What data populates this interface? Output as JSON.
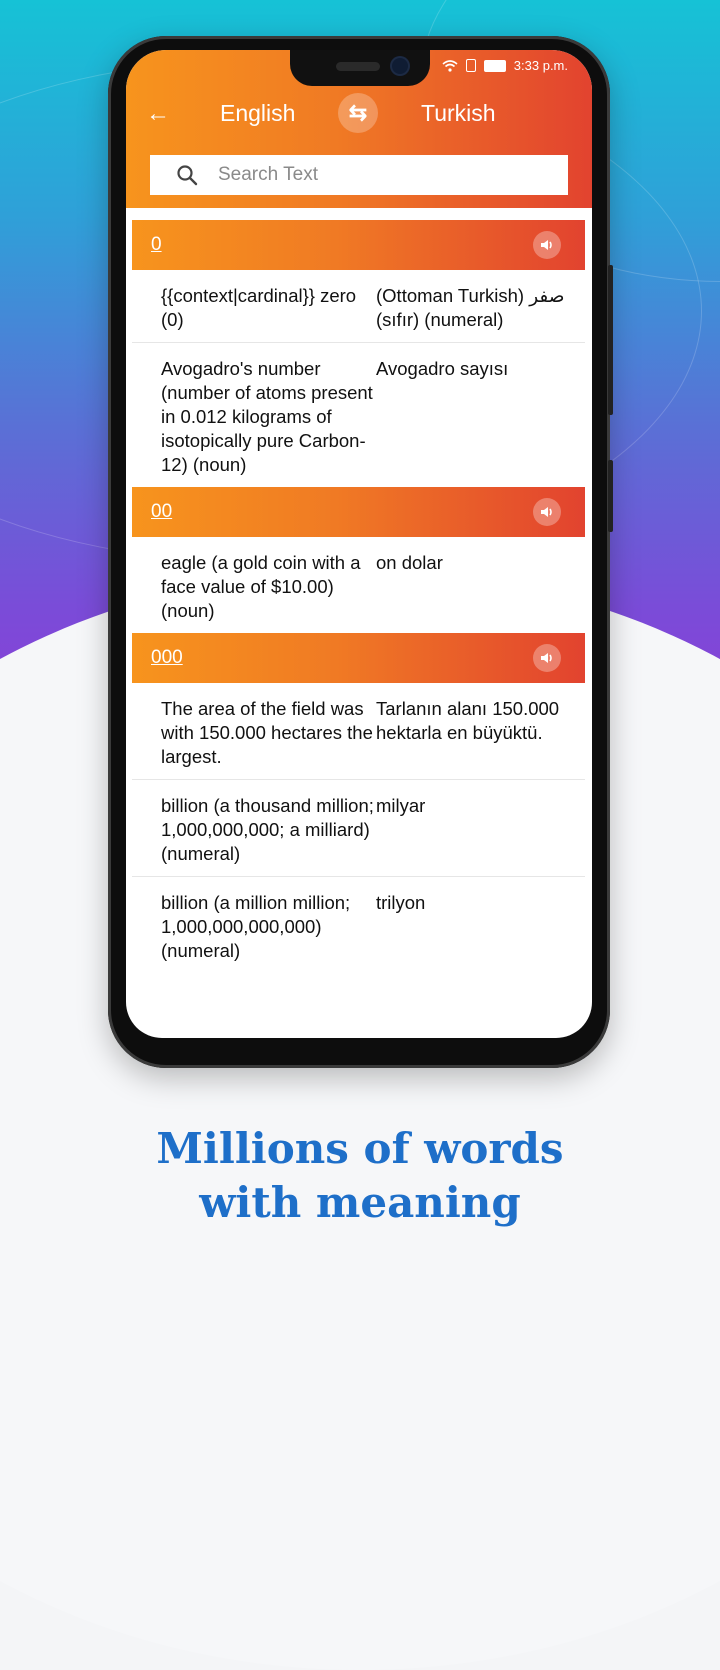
{
  "status_bar": {
    "time": "3:33 p.m."
  },
  "toolbar": {
    "source_language": "English",
    "target_language": "Turkish"
  },
  "search": {
    "placeholder": "Search Text",
    "value": ""
  },
  "entries": [
    {
      "word": "0",
      "translations": [
        {
          "en": "{{context|cardinal}} zero (0)",
          "tr": "(Ottoman Turkish) صفر (sıfır) (numeral)"
        },
        {
          "en": "Avogadro's number (number of atoms present in 0.012 kilograms of isotopically pure Carbon-12) (noun)",
          "tr": "Avogadro sayısı"
        }
      ]
    },
    {
      "word": "00",
      "translations": [
        {
          "en": "eagle (a gold coin with a face value of $10.00) (noun)",
          "tr": "on dolar"
        }
      ]
    },
    {
      "word": "000",
      "translations": [
        {
          "en": "The area of the field was with 150.000 hectares the largest.",
          "tr": "Tarlanın alanı 150.000 hektarla en büyüktü."
        },
        {
          "en": "billion (a thousand million; 1,000,000,000; a milliard) (numeral)",
          "tr": "milyar"
        },
        {
          "en": "billion (a million million; 1,000,000,000,000) (numeral)",
          "tr": "trilyon"
        }
      ]
    }
  ],
  "tagline": {
    "line1": "Millions of words",
    "line2": "with meaning"
  },
  "colors": {
    "header_gradient_start": "#f7941d",
    "header_gradient_end": "#e2432f",
    "tagline": "#1e6fc9"
  }
}
